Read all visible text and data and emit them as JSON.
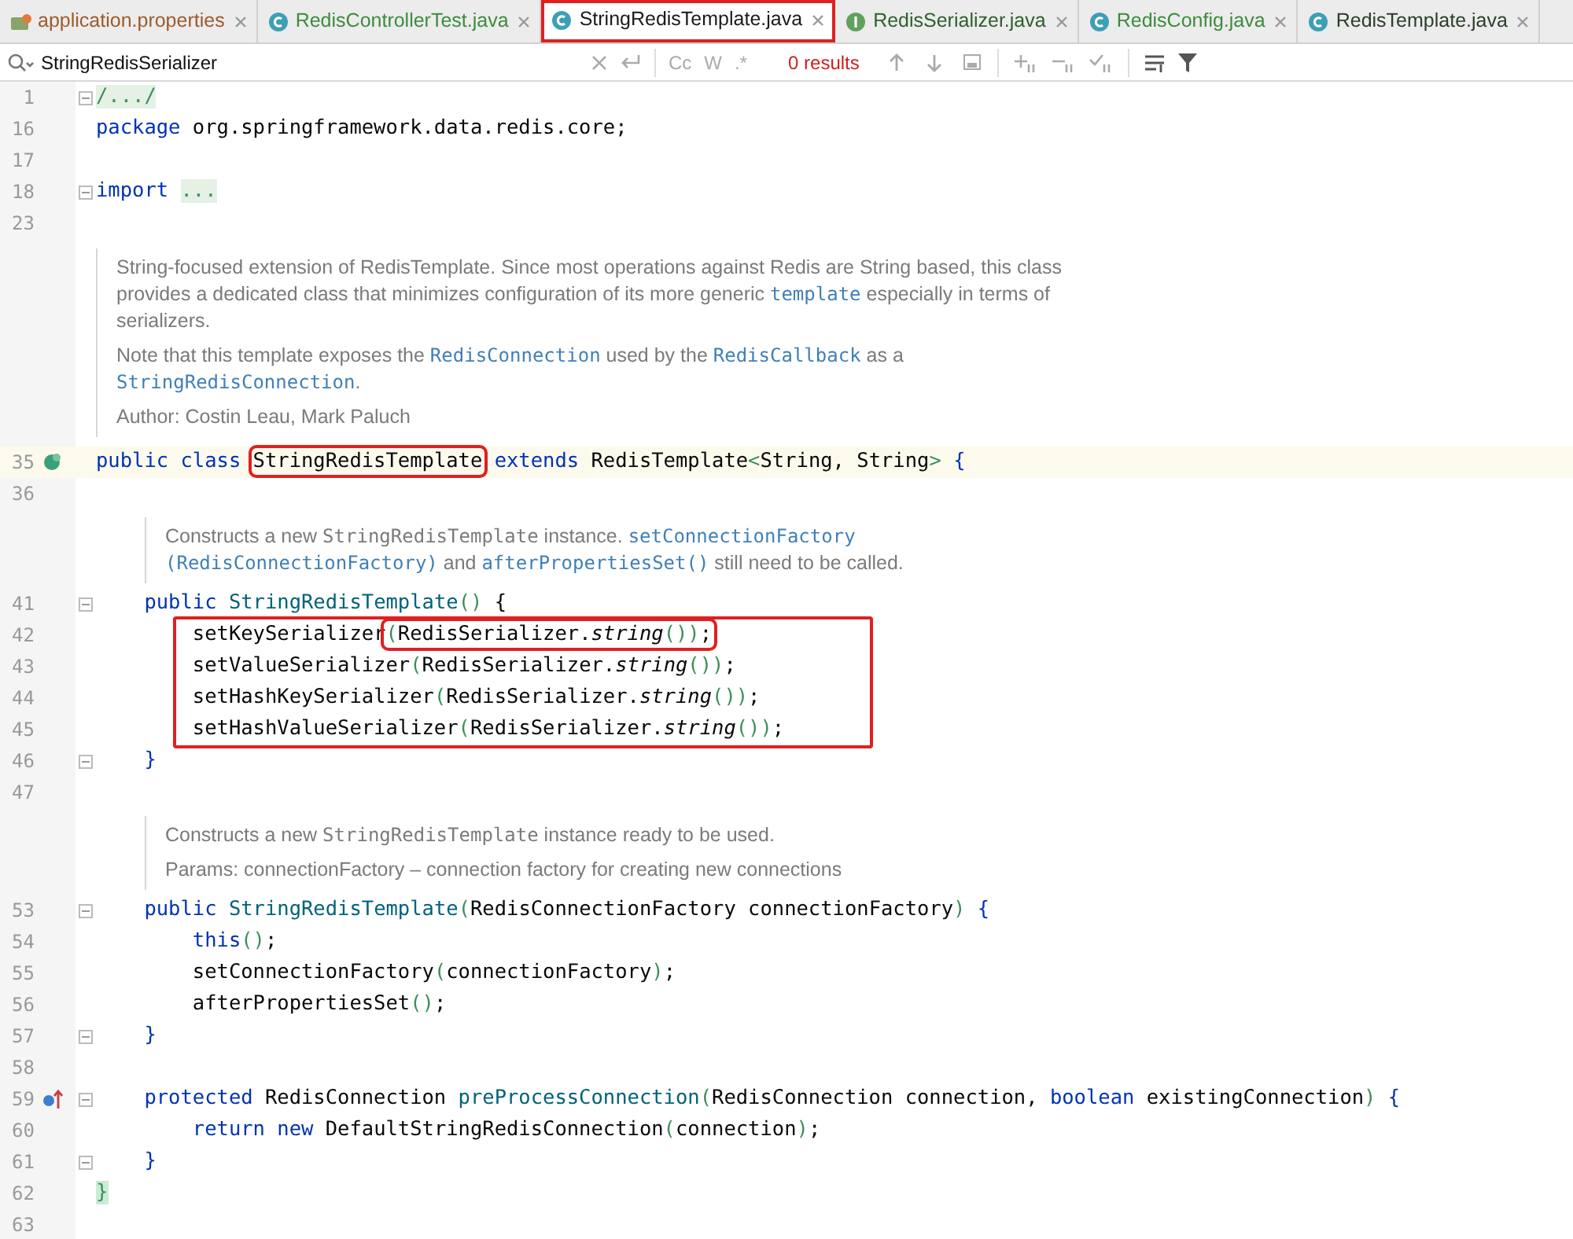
{
  "tabs": [
    {
      "label": "application.properties",
      "kind": "properties",
      "color": "#9c5a2a",
      "selected": false,
      "boxed": false
    },
    {
      "label": "RedisControllerTest.java",
      "kind": "class",
      "color": "#3d8b3d",
      "selected": false,
      "boxed": false
    },
    {
      "label": "StringRedisTemplate.java",
      "kind": "class",
      "color": "#1a1a1a",
      "selected": true,
      "boxed": true
    },
    {
      "label": "RedisSerializer.java",
      "kind": "interface",
      "color": "#2f5e2f",
      "selected": false,
      "boxed": false
    },
    {
      "label": "RedisConfig.java",
      "kind": "class",
      "color": "#3d8b3d",
      "selected": false,
      "boxed": false
    },
    {
      "label": "RedisTemplate.java",
      "kind": "class",
      "color": "#2a3f2a",
      "selected": false,
      "boxed": false
    }
  ],
  "search": {
    "value": "StringRedisSerializer",
    "case_label": "Cc",
    "word_label": "W",
    "regex_label": ".*",
    "results": "0 results"
  },
  "editor": [
    {
      "kind": "line",
      "n": "1",
      "fold": true,
      "tokens": [
        {
          "kind": "folded",
          "text": "/.../"
        }
      ]
    },
    {
      "kind": "line",
      "n": "16",
      "tokens": [
        {
          "kind": "kw",
          "text": "package"
        },
        {
          "kind": "plain",
          "text": " org.springframework.data.redis.core;"
        }
      ]
    },
    {
      "kind": "line",
      "n": "17"
    },
    {
      "kind": "line",
      "n": "18",
      "fold": true,
      "tokens": [
        {
          "kind": "kw",
          "text": "import "
        },
        {
          "kind": "folded",
          "text": "..."
        }
      ]
    },
    {
      "kind": "line",
      "n": "23"
    },
    {
      "kind": "class_doc",
      "paragraphs": [
        [
          {
            "kind": "text",
            "text": "String-focused extension of RedisTemplate. Since most operations against Redis are String based, this class provides a dedicated class that minimizes configuration of its more generic "
          },
          {
            "kind": "link",
            "text": "template"
          },
          {
            "kind": "text",
            "text": " especially in terms of serializers."
          }
        ],
        [
          {
            "kind": "text",
            "text": "Note that this template exposes the "
          },
          {
            "kind": "link",
            "text": "RedisConnection"
          },
          {
            "kind": "text",
            "text": " used by the "
          },
          {
            "kind": "link",
            "text": "RedisCallback"
          },
          {
            "kind": "text",
            "text": " as a "
          },
          {
            "kind": "link",
            "text": "StringRedisConnection"
          },
          {
            "kind": "text",
            "text": "."
          }
        ],
        [
          {
            "kind": "text",
            "text": "Author: Costin Leau, Mark Paluch"
          }
        ]
      ]
    },
    {
      "kind": "class_line",
      "n": "35",
      "current": true,
      "tokens": [
        {
          "kind": "kw",
          "text": "public class "
        },
        {
          "kind": "plain",
          "text": "StringRedisTemplate",
          "boxed": true
        },
        {
          "kind": "kw",
          "text": " extends "
        },
        {
          "kind": "plain",
          "text": "RedisTemplate"
        },
        {
          "kind": "generic",
          "text": "<"
        },
        {
          "kind": "plain",
          "text": "String, String"
        },
        {
          "kind": "generic",
          "text": "> "
        },
        {
          "kind": "brace",
          "text": "{"
        }
      ]
    },
    {
      "kind": "line",
      "n": "36"
    },
    {
      "kind": "member_doc",
      "paragraphs": [
        [
          {
            "kind": "text",
            "text": "Constructs a new "
          },
          {
            "kind": "code",
            "text": "StringRedisTemplate"
          },
          {
            "kind": "text",
            "text": " instance. "
          },
          {
            "kind": "link",
            "text": "setConnectionFactory"
          },
          {
            "kind": "link",
            "text": "(RedisConnectionFactory)"
          },
          {
            "kind": "text",
            "text": " and "
          },
          {
            "kind": "link",
            "text": "afterPropertiesSet()"
          },
          {
            "kind": "text",
            "text": " still need to be called."
          }
        ]
      ]
    },
    {
      "kind": "line",
      "n": "41",
      "fold": true,
      "tokens": [
        {
          "kind": "kw",
          "text": "    public "
        },
        {
          "kind": "decl",
          "text": "StringRedisTemplate"
        },
        {
          "kind": "paren",
          "text": "()"
        },
        {
          "kind": "plain",
          "text": " {"
        }
      ]
    },
    {
      "kind": "group",
      "boxed": true,
      "lines": [
        {
          "kind": "line",
          "n": "42",
          "tokens": [
            {
              "kind": "plain",
              "text": "        setKeySerializer"
            },
            {
              "kind": "paren",
              "text": "(",
              "boxed": true
            },
            {
              "kind": "plain",
              "text": "RedisSerializer.",
              "boxed": true
            },
            {
              "kind": "italic",
              "text": "string",
              "boxed": true
            },
            {
              "kind": "paren",
              "text": "())",
              "boxed": true
            },
            {
              "kind": "plain",
              "text": ";",
              "boxed": true
            }
          ]
        },
        {
          "kind": "line",
          "n": "43",
          "tokens": [
            {
              "kind": "plain",
              "text": "        setValueSerializer"
            },
            {
              "kind": "paren",
              "text": "("
            },
            {
              "kind": "plain",
              "text": "RedisSerializer."
            },
            {
              "kind": "italic",
              "text": "string"
            },
            {
              "kind": "paren",
              "text": "())"
            },
            {
              "kind": "plain",
              "text": ";"
            }
          ]
        },
        {
          "kind": "line",
          "n": "44",
          "tokens": [
            {
              "kind": "plain",
              "text": "        setHashKeySerializer"
            },
            {
              "kind": "paren",
              "text": "("
            },
            {
              "kind": "plain",
              "text": "RedisSerializer."
            },
            {
              "kind": "italic",
              "text": "string"
            },
            {
              "kind": "paren",
              "text": "())"
            },
            {
              "kind": "plain",
              "text": ";"
            }
          ]
        },
        {
          "kind": "line",
          "n": "45",
          "tokens": [
            {
              "kind": "plain",
              "text": "        setHashValueSerializer"
            },
            {
              "kind": "paren",
              "text": "("
            },
            {
              "kind": "plain",
              "text": "RedisSerializer."
            },
            {
              "kind": "italic",
              "text": "string"
            },
            {
              "kind": "paren",
              "text": "())"
            },
            {
              "kind": "plain",
              "text": ";"
            }
          ]
        }
      ]
    },
    {
      "kind": "line",
      "n": "46",
      "fold": true,
      "tokens": [
        {
          "kind": "brace",
          "text": "    }"
        }
      ]
    },
    {
      "kind": "line",
      "n": "47"
    },
    {
      "kind": "member_doc",
      "paragraphs": [
        [
          {
            "kind": "text",
            "text": "Constructs a new "
          },
          {
            "kind": "code",
            "text": "StringRedisTemplate"
          },
          {
            "kind": "text",
            "text": " instance ready to be used."
          }
        ],
        [
          {
            "kind": "text",
            "text": "Params: connectionFactory – connection factory for creating new connections"
          }
        ]
      ]
    },
    {
      "kind": "line",
      "n": "53",
      "fold": true,
      "tokens": [
        {
          "kind": "kw",
          "text": "    public "
        },
        {
          "kind": "decl",
          "text": "StringRedisTemplate"
        },
        {
          "kind": "paren",
          "text": "("
        },
        {
          "kind": "plain",
          "text": "RedisConnectionFactory connectionFactory"
        },
        {
          "kind": "paren",
          "text": ")"
        },
        {
          "kind": "brace",
          "text": " {"
        }
      ]
    },
    {
      "kind": "line",
      "n": "54",
      "tokens": [
        {
          "kind": "kw",
          "text": "        this"
        },
        {
          "kind": "paren",
          "text": "()"
        },
        {
          "kind": "plain",
          "text": ";"
        }
      ]
    },
    {
      "kind": "line",
      "n": "55",
      "tokens": [
        {
          "kind": "plain",
          "text": "        setConnectionFactory"
        },
        {
          "kind": "paren",
          "text": "("
        },
        {
          "kind": "plain",
          "text": "connectionFactory"
        },
        {
          "kind": "paren",
          "text": ")"
        },
        {
          "kind": "plain",
          "text": ";"
        }
      ]
    },
    {
      "kind": "line",
      "n": "56",
      "tokens": [
        {
          "kind": "plain",
          "text": "        afterPropertiesSet"
        },
        {
          "kind": "paren",
          "text": "()"
        },
        {
          "kind": "plain",
          "text": ";"
        }
      ]
    },
    {
      "kind": "line",
      "n": "57",
      "fold": true,
      "tokens": [
        {
          "kind": "brace",
          "text": "    }"
        }
      ]
    },
    {
      "kind": "line",
      "n": "58"
    },
    {
      "kind": "override_line",
      "n": "59",
      "fold": true,
      "tokens": [
        {
          "kind": "kw",
          "text": "    protected "
        },
        {
          "kind": "plain",
          "text": "RedisConnection "
        },
        {
          "kind": "decl",
          "text": "preProcessConnection"
        },
        {
          "kind": "paren",
          "text": "("
        },
        {
          "kind": "plain",
          "text": "RedisConnection connection, "
        },
        {
          "kind": "kw",
          "text": "boolean "
        },
        {
          "kind": "plain",
          "text": "existingConnection"
        },
        {
          "kind": "paren",
          "text": ")"
        },
        {
          "kind": "brace",
          "text": " {"
        }
      ]
    },
    {
      "kind": "line",
      "n": "60",
      "tokens": [
        {
          "kind": "kw",
          "text": "        return new "
        },
        {
          "kind": "plain",
          "text": "DefaultStringRedisConnection"
        },
        {
          "kind": "paren",
          "text": "("
        },
        {
          "kind": "plain",
          "text": "connection"
        },
        {
          "kind": "paren",
          "text": ")"
        },
        {
          "kind": "plain",
          "text": ";"
        }
      ]
    },
    {
      "kind": "line",
      "n": "61",
      "fold": true,
      "tokens": [
        {
          "kind": "brace",
          "text": "    }"
        }
      ]
    },
    {
      "kind": "line",
      "n": "62",
      "tokens": [
        {
          "kind": "matched",
          "text": "}"
        }
      ]
    },
    {
      "kind": "line",
      "n": "63"
    }
  ]
}
